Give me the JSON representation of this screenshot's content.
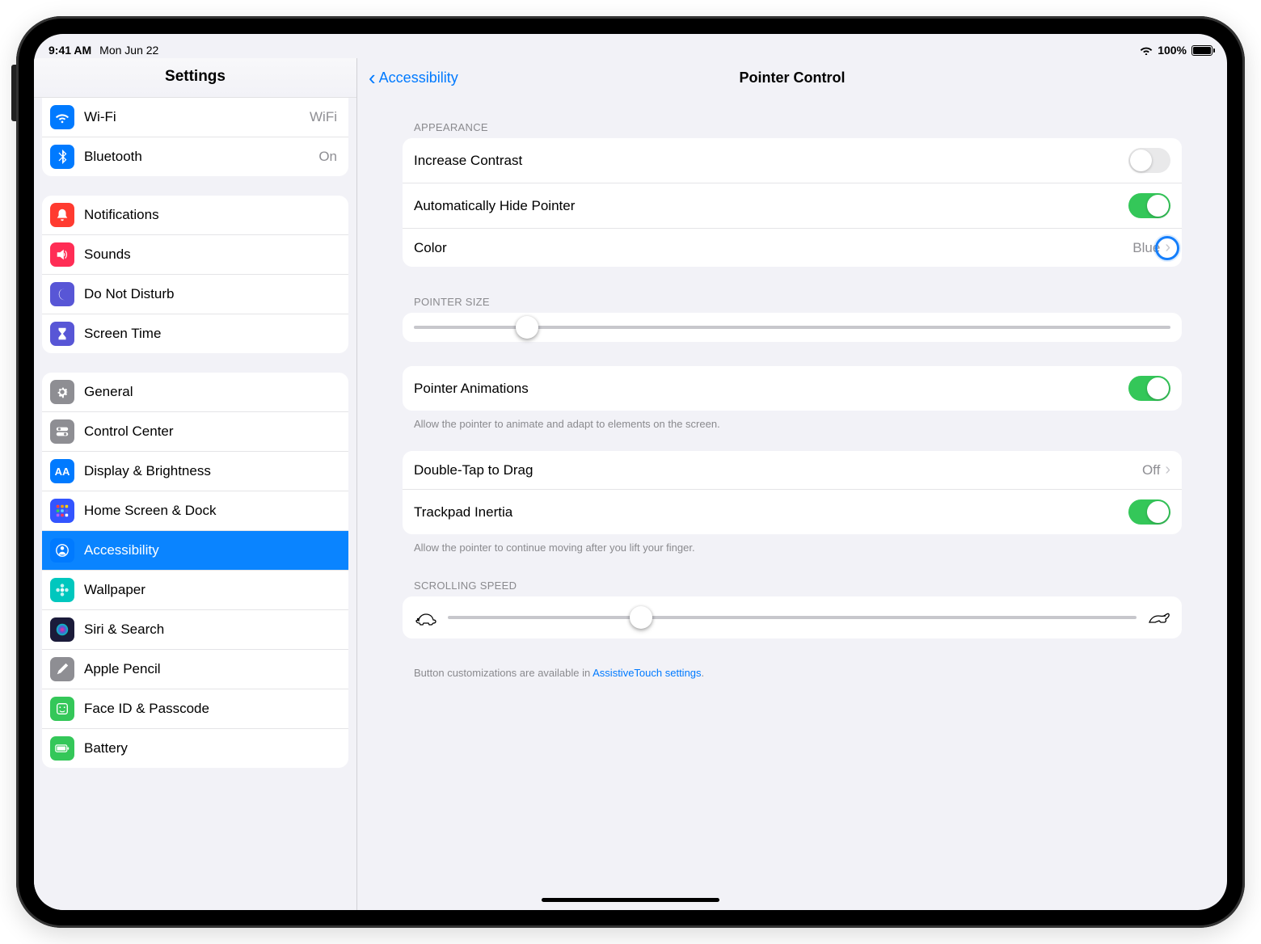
{
  "status": {
    "time": "9:41 AM",
    "date": "Mon Jun 22",
    "battery_pct": "100%"
  },
  "sidebar": {
    "title": "Settings",
    "group1": [
      {
        "label": "Wi-Fi",
        "value": "WiFi",
        "icon": "wifi",
        "bg": "#007aff"
      },
      {
        "label": "Bluetooth",
        "value": "On",
        "icon": "bluetooth",
        "bg": "#007aff"
      }
    ],
    "group2": [
      {
        "label": "Notifications",
        "icon": "bell",
        "bg": "#ff3b30"
      },
      {
        "label": "Sounds",
        "icon": "speaker",
        "bg": "#ff2d55"
      },
      {
        "label": "Do Not Disturb",
        "icon": "moon",
        "bg": "#5856d6"
      },
      {
        "label": "Screen Time",
        "icon": "hourglass",
        "bg": "#5856d6"
      }
    ],
    "group3": [
      {
        "label": "General",
        "icon": "gear",
        "bg": "#8e8e93"
      },
      {
        "label": "Control Center",
        "icon": "switches",
        "bg": "#8e8e93"
      },
      {
        "label": "Display & Brightness",
        "icon": "AA",
        "bg": "#007aff"
      },
      {
        "label": "Home Screen & Dock",
        "icon": "grid",
        "bg": "#3355ff"
      },
      {
        "label": "Accessibility",
        "icon": "person",
        "bg": "#007aff",
        "selected": true
      },
      {
        "label": "Wallpaper",
        "icon": "flower",
        "bg": "#00c7be"
      },
      {
        "label": "Siri & Search",
        "icon": "siri",
        "bg": "#1b1b3a"
      },
      {
        "label": "Apple Pencil",
        "icon": "pencil",
        "bg": "#8e8e93"
      },
      {
        "label": "Face ID & Passcode",
        "icon": "face",
        "bg": "#34c759"
      },
      {
        "label": "Battery",
        "icon": "battery",
        "bg": "#34c759"
      }
    ]
  },
  "detail": {
    "back_label": "Accessibility",
    "title": "Pointer Control",
    "appearance_header": "APPEARANCE",
    "increase_contrast": {
      "label": "Increase Contrast",
      "on": false
    },
    "auto_hide": {
      "label": "Automatically Hide Pointer",
      "on": true
    },
    "color": {
      "label": "Color",
      "value": "Blue"
    },
    "pointer_size_header": "POINTER SIZE",
    "pointer_size_value": 0.15,
    "pointer_animations": {
      "label": "Pointer Animations",
      "on": true
    },
    "pointer_animations_footnote": "Allow the pointer to animate and adapt to elements on the screen.",
    "double_tap": {
      "label": "Double-Tap to Drag",
      "value": "Off"
    },
    "trackpad_inertia": {
      "label": "Trackpad Inertia",
      "on": true
    },
    "inertia_footnote": "Allow the pointer to continue moving after you lift your finger.",
    "scrolling_header": "SCROLLING SPEED",
    "scrolling_value": 0.28,
    "button_note_prefix": "Button customizations are available in ",
    "button_note_link": "AssistiveTouch settings",
    "button_note_suffix": "."
  }
}
